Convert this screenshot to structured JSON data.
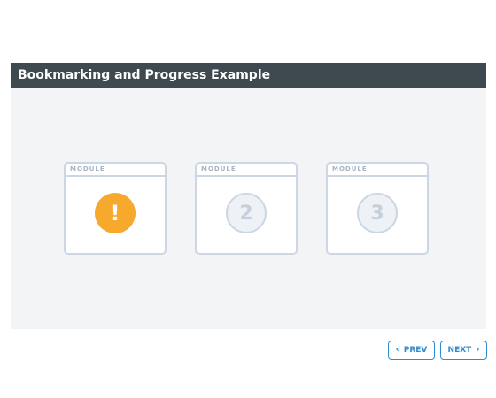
{
  "title": "Bookmarking and Progress Example",
  "modules": [
    {
      "header": "MODULE",
      "state": "alert",
      "badge": "!"
    },
    {
      "header": "MODULE",
      "state": "locked",
      "badge": "2"
    },
    {
      "header": "MODULE",
      "state": "locked",
      "badge": "3"
    }
  ],
  "nav": {
    "prev_label": "PREV",
    "next_label": "NEXT",
    "prev_icon": "chevron-left-icon",
    "next_icon": "chevron-right-icon"
  },
  "colors": {
    "titlebar": "#3f4a50",
    "accent_blue": "#2e8dd1",
    "alert_orange": "#f6a92c",
    "card_border": "#ccd7e3"
  }
}
